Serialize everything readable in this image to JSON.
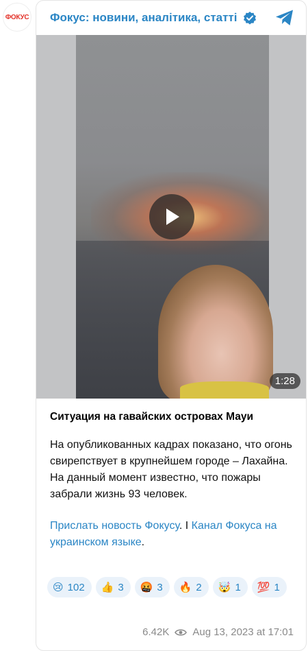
{
  "channel": {
    "avatar_text": "ФОКУС",
    "name": "Фокус: новини, аналітика, статті"
  },
  "video": {
    "duration": "1:28"
  },
  "post": {
    "title": "Ситуация на гавайских островах Мауи",
    "body": "На опубликованных кадрах показано, что огонь свирепствует в крупнейшем городе – Лахайна. На данный момент известно, что пожары забрали жизнь 93 человек.",
    "link1": "Прислать новость Фокусу",
    "separator": ". I ",
    "link2": "Канал Фокуса на украинском языке",
    "end": "."
  },
  "reactions": [
    {
      "emoji": "😢",
      "count": "102"
    },
    {
      "emoji": "👍",
      "count": "3"
    },
    {
      "emoji": "🤬",
      "count": "3"
    },
    {
      "emoji": "🔥",
      "count": "2"
    },
    {
      "emoji": "🤯",
      "count": "1"
    },
    {
      "emoji": "💯",
      "count": "1"
    }
  ],
  "meta": {
    "views": "6.42K",
    "date": "Aug 13, 2023 at 17:01"
  },
  "colors": {
    "accent": "#2b86c5",
    "brand_red": "#e3342b",
    "reaction_bg": "#eaf2fa"
  }
}
